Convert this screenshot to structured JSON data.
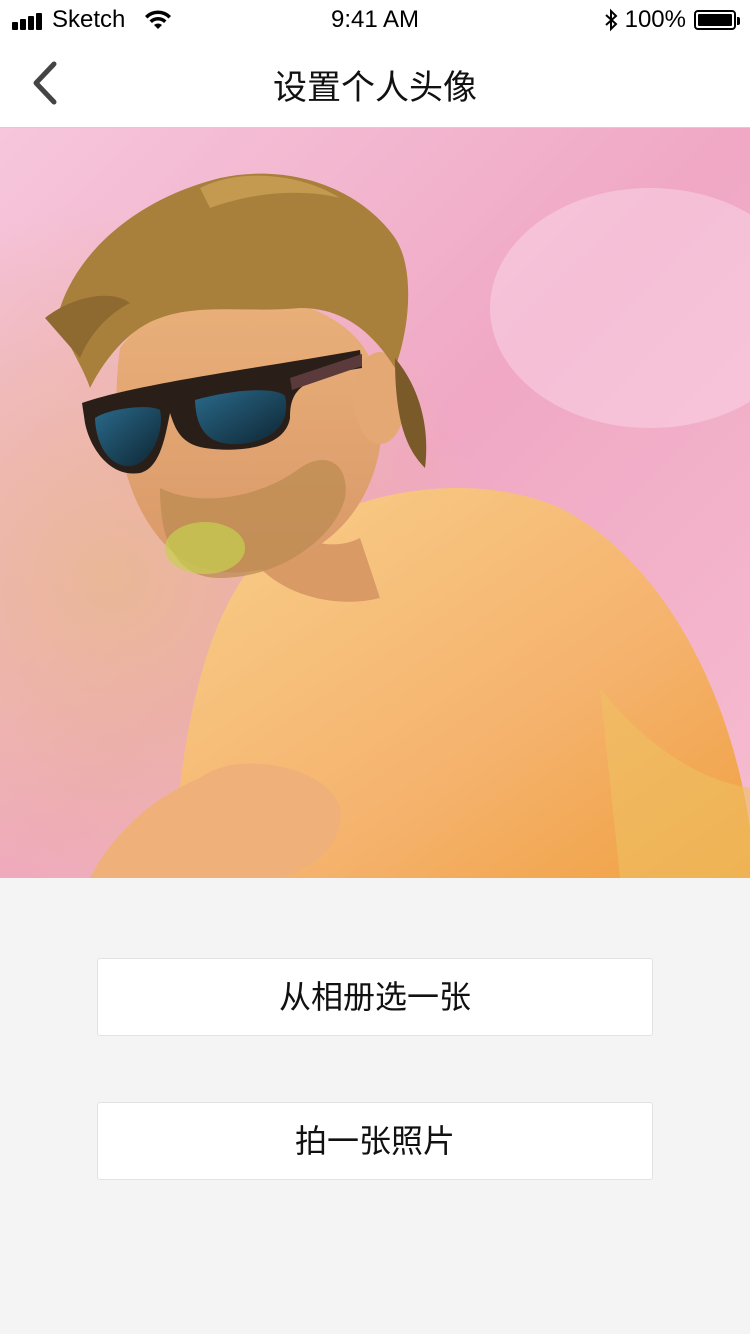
{
  "status_bar": {
    "carrier": "Sketch",
    "time": "9:41 AM",
    "battery": "100%"
  },
  "nav": {
    "title": "设置个人头像",
    "back_icon": "chevron-left-icon"
  },
  "photo": {
    "description_icon": "avatar-photo"
  },
  "actions": {
    "choose_from_album": "从相册选一张",
    "take_photo": "拍一张照片"
  },
  "colors": {
    "background": "#f4f4f4",
    "bar": "#ffffff",
    "text": "#111111"
  }
}
